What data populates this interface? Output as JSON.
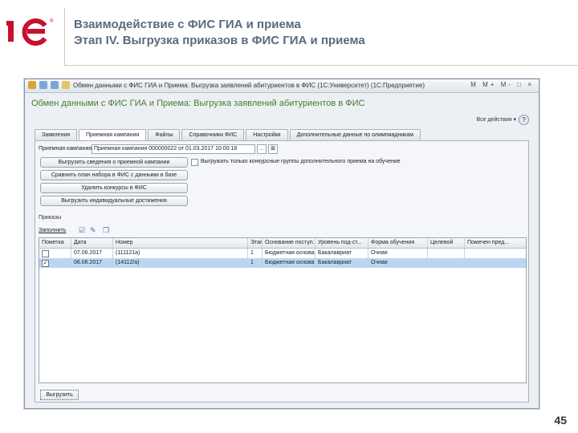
{
  "slide": {
    "logo_text": "1С",
    "title_line1": "Взаимодействие с ФИС ГИА и приема",
    "title_line2": "Этап IV. Выгрузка приказов в ФИС ГИА и приема",
    "page_number": "45"
  },
  "window": {
    "title": "Обмен данными с ФИС ГИА и Приема: Выгрузка заявлений абитуриентов в ФИС (1С:Университет) (1С:Предприятие)",
    "controls": "M  M+ M-  □  ×"
  },
  "form": {
    "title": "Обмен данными с ФИС ГИА и Приема: Выгрузка заявлений абитуриентов в ФИС",
    "all_actions": "Все действия ▾",
    "help": "?",
    "tabs": [
      {
        "label": "Заявления"
      },
      {
        "label": "Приемная кампания"
      },
      {
        "label": "Файлы"
      },
      {
        "label": "Справочники ФИС"
      },
      {
        "label": "Настройки"
      },
      {
        "label": "Дополнительные данные по олимпиадникам"
      }
    ],
    "campaign_label": "Приемная кампания:",
    "campaign_value": "Приемная кампания 000000022 от 01.03.2017 10:00:18",
    "campaign_btn1": "...",
    "campaign_btn2": "⊞",
    "buttons": [
      "Выгрузить сведения о приемной кампании",
      "Сравнить план набора в ФИС с данными в базе",
      "Удалить конкурсы в ФИС",
      "Выгрузить индивидуальные достижения"
    ],
    "only_groups_label": "Выгружать только конкурсные группы дополнительного приема на обучение",
    "orders_section": "Приказы",
    "fill_label": "Заполнить",
    "grid": {
      "columns": [
        "Пометка",
        "Дата",
        "Номер",
        "Этап",
        "Основание поступ...",
        "Уровень под-ст...",
        "Форма обучения",
        "Целевой",
        "Помечен пред..."
      ],
      "rows": [
        {
          "checked": false,
          "date": "07.06.2017",
          "number": "(111121а)",
          "stage": "1",
          "basis": "Бюджетная основа",
          "level": "Бакалавриат",
          "form": "Очная",
          "target": "",
          "marked": ""
        },
        {
          "checked": true,
          "date": "06.06.2017",
          "number": "(14112/а)",
          "stage": "1",
          "basis": "Бюджетная основа",
          "level": "Бакалавриат",
          "form": "Очная",
          "target": "",
          "marked": ""
        }
      ]
    },
    "upload_button": "Выгрузить"
  },
  "colors": {
    "title_text": "#5a6a7e",
    "form_title": "#4b7c2a",
    "selected_row": "#bcd6f2",
    "logo_red": "#c8102e"
  }
}
